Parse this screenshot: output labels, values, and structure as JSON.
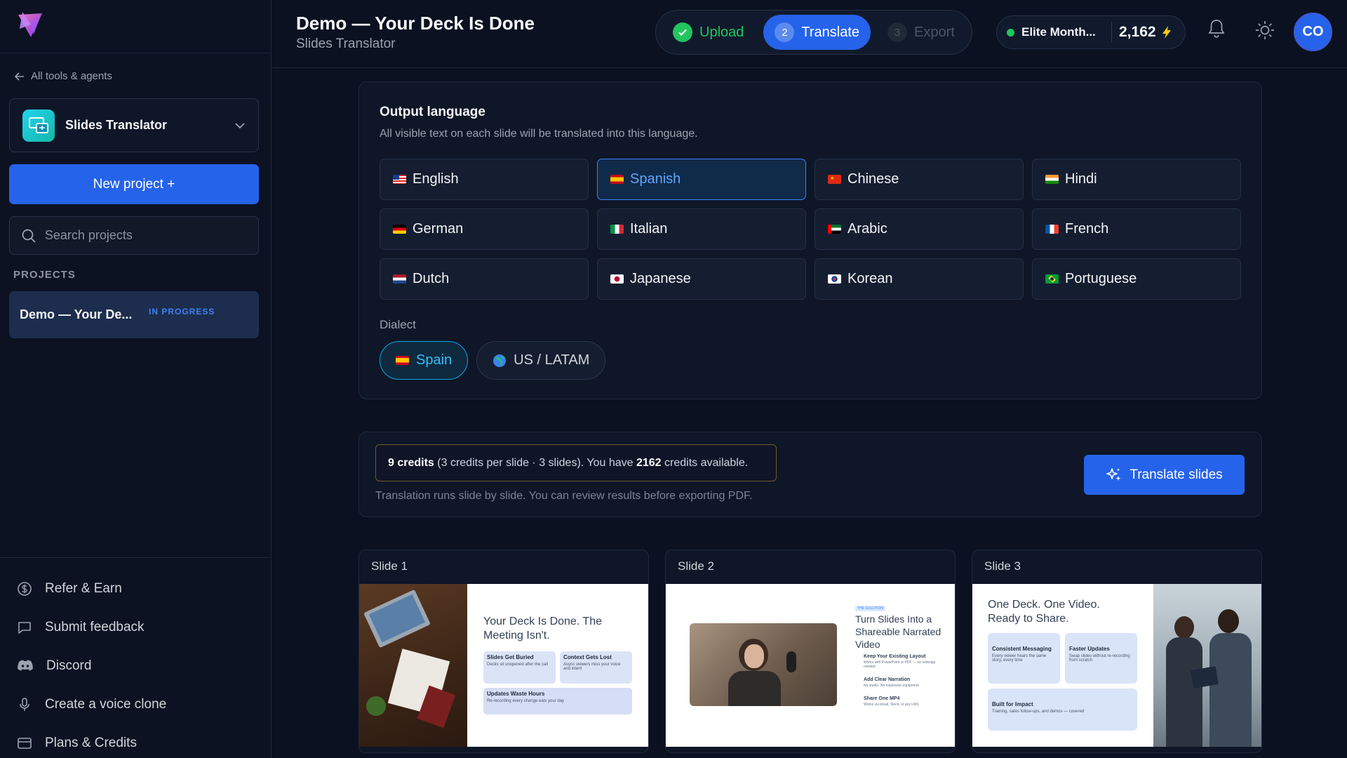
{
  "sidebar": {
    "back_label": "All tools & agents",
    "tool_name": "Slides Translator",
    "new_project_label": "New project +",
    "search_placeholder": "Search projects",
    "projects_heading": "PROJECTS",
    "projects": [
      {
        "name": "Demo — Your De...",
        "status": "IN PROGRESS"
      }
    ],
    "footer_links": [
      {
        "label": "Refer & Earn",
        "icon": "dollar-circle-icon"
      },
      {
        "label": "Submit feedback",
        "icon": "message-square-icon"
      },
      {
        "label": "Discord",
        "icon": "discord-icon"
      },
      {
        "label": "Create a voice clone",
        "icon": "microphone-icon"
      },
      {
        "label": "Plans & Credits",
        "icon": "credit-card-icon"
      }
    ]
  },
  "header": {
    "title": "Demo — Your Deck Is Done",
    "subtitle": "Slides Translator",
    "steps": [
      {
        "label": "Upload",
        "state": "done"
      },
      {
        "number": "2",
        "label": "Translate",
        "state": "active"
      },
      {
        "number": "3",
        "label": "Export",
        "state": "pending"
      }
    ],
    "plan_name": "Elite Month...",
    "credits": "2,162",
    "avatar_initials": "CO"
  },
  "language_panel": {
    "title": "Output language",
    "description": "All visible text on each slide will be translated into this language.",
    "languages": [
      {
        "label": "English",
        "flag": "us"
      },
      {
        "label": "Spanish",
        "flag": "es",
        "selected": true
      },
      {
        "label": "Chinese",
        "flag": "cn"
      },
      {
        "label": "Hindi",
        "flag": "in"
      },
      {
        "label": "German",
        "flag": "de"
      },
      {
        "label": "Italian",
        "flag": "it"
      },
      {
        "label": "Arabic",
        "flag": "ae"
      },
      {
        "label": "French",
        "flag": "fr"
      },
      {
        "label": "Dutch",
        "flag": "nl"
      },
      {
        "label": "Japanese",
        "flag": "jp"
      },
      {
        "label": "Korean",
        "flag": "kr"
      },
      {
        "label": "Portuguese",
        "flag": "br"
      }
    ],
    "dialect_label": "Dialect",
    "dialects": [
      {
        "label": "Spain",
        "icon": "spain-flag-icon",
        "selected": true
      },
      {
        "label": "US / LATAM",
        "icon": "globe-icon"
      }
    ]
  },
  "credits_panel": {
    "cost_bold": "9 credits",
    "cost_detail": "(3 credits per slide · 3 slides). You have",
    "available_bold": "2162",
    "available_suffix": "credits available.",
    "note": "Translation runs slide by slide. You can review results before exporting PDF.",
    "translate_button": "Translate slides"
  },
  "slides": [
    {
      "label": "Slide 1",
      "heading": "Your Deck Is Done. The Meeting Isn't.",
      "cards": [
        {
          "title": "Slides Get Buried",
          "text": "Decks sit unopened after the call"
        },
        {
          "title": "Context Gets Lost",
          "text": "Async viewers miss your voice and intent"
        },
        {
          "title": "Updates Waste Hours",
          "text": "Re-recording every change eats your day"
        }
      ]
    },
    {
      "label": "Slide 2",
      "tag": "THE SOLUTION",
      "heading": "Turn Slides Into a Shareable Narrated Video",
      "items": [
        {
          "title": "Keep Your Existing Layout",
          "text": "Works with PowerPoint or PDF — no redesign needed"
        },
        {
          "title": "Add Clear Narration",
          "text": "No studio. No expensive equipment"
        },
        {
          "title": "Share One MP4",
          "text": "Works via email, Slack, or any LMS"
        }
      ]
    },
    {
      "label": "Slide 3",
      "heading": "One Deck. One Video. Ready to Share.",
      "cards": [
        {
          "title": "Consistent Messaging",
          "text": "Every viewer hears the same story, every time"
        },
        {
          "title": "Faster Updates",
          "text": "Swap slides without re-recording from scratch"
        },
        {
          "title": "Built for Impact",
          "text": "Training, sales follow-ups, and demos — covered"
        }
      ]
    }
  ],
  "colors": {
    "accent": "#2563eb",
    "success": "#22c55e",
    "background": "#0b1120",
    "panel": "#0e1627"
  }
}
